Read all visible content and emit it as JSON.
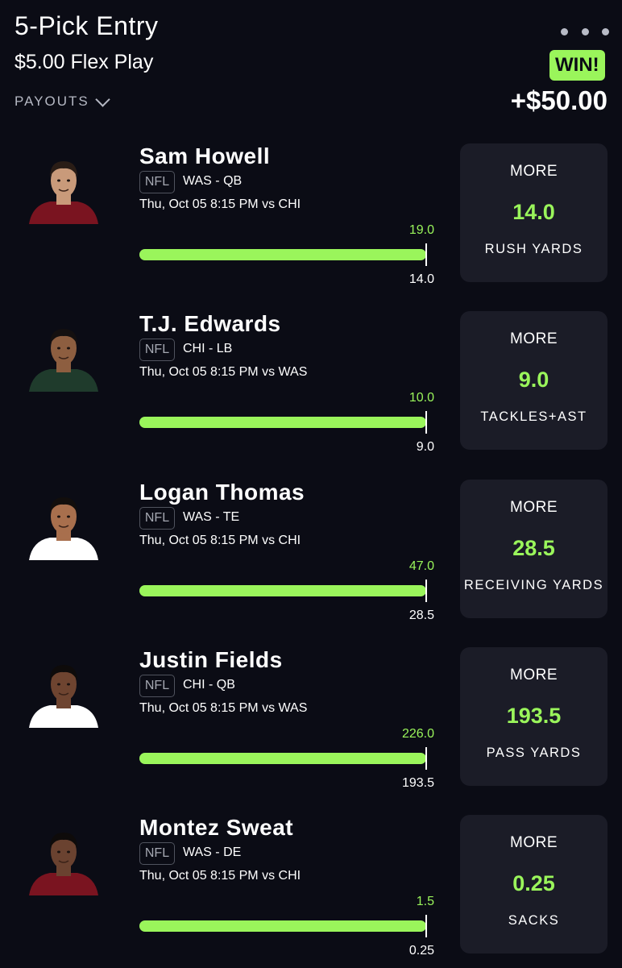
{
  "header": {
    "title": "5-Pick Entry",
    "play_type": "$5.00 Flex Play",
    "payouts_label": "PAYOUTS",
    "result_badge": "WIN!",
    "payout": "+$50.00"
  },
  "colors": {
    "background": "#0b0c15",
    "card": "#1b1c27",
    "accent_green": "#9af55b",
    "muted_text": "#b5b8c3"
  },
  "icons": [
    "more-menu-icon",
    "chevron-down-icon"
  ],
  "picks": [
    {
      "name": "Sam Howell",
      "league": "NFL",
      "team_position": "WAS - QB",
      "game": "Thu, Oct 05 8:15 PM  vs CHI",
      "actual": "19.0",
      "line_label": "14.0",
      "direction": "MORE",
      "line": "14.0",
      "stat": "RUSH YARDS",
      "progress": 1.0,
      "jersey_color": "#7a1420",
      "skin": "#c99a7a",
      "hair": "#2a1d16"
    },
    {
      "name": "T.J. Edwards",
      "league": "NFL",
      "team_position": "CHI - LB",
      "game": "Thu, Oct 05 8:15 PM  vs WAS",
      "actual": "10.0",
      "line_label": "9.0",
      "direction": "MORE",
      "line": "9.0",
      "stat": "TACKLES+AST",
      "progress": 1.0,
      "jersey_color": "#1f3b2c",
      "skin": "#8d5e40",
      "hair": "#141010"
    },
    {
      "name": "Logan Thomas",
      "league": "NFL",
      "team_position": "WAS - TE",
      "game": "Thu, Oct 05 8:15 PM  vs CHI",
      "actual": "47.0",
      "line_label": "28.5",
      "direction": "MORE",
      "line": "28.5",
      "stat": "RECEIVING YARDS",
      "progress": 1.0,
      "jersey_color": "#ffffff",
      "skin": "#a86f4d",
      "hair": "#120e0c"
    },
    {
      "name": "Justin Fields",
      "league": "NFL",
      "team_position": "CHI - QB",
      "game": "Thu, Oct 05 8:15 PM  vs WAS",
      "actual": "226.0",
      "line_label": "193.5",
      "direction": "MORE",
      "line": "193.5",
      "stat": "PASS YARDS",
      "progress": 1.0,
      "jersey_color": "#ffffff",
      "skin": "#6e4430",
      "hair": "#0e0b0a"
    },
    {
      "name": "Montez Sweat",
      "league": "NFL",
      "team_position": "WAS - DE",
      "game": "Thu, Oct 05 8:15 PM  vs CHI",
      "actual": "1.5",
      "line_label": "0.25",
      "direction": "MORE",
      "line": "0.25",
      "stat": "SACKS",
      "progress": 1.0,
      "jersey_color": "#7a1420",
      "skin": "#6a4230",
      "hair": "#0e0b0a"
    }
  ]
}
